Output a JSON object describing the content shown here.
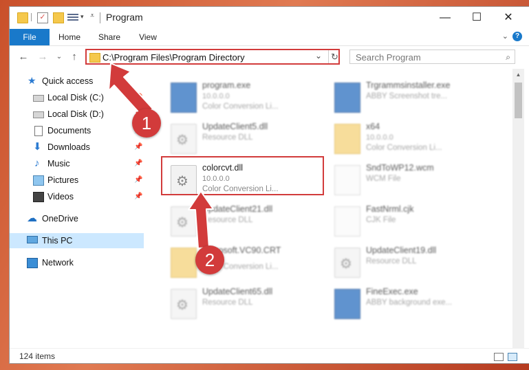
{
  "window": {
    "title": "Program"
  },
  "ribbon": {
    "tabs": [
      "File",
      "Home",
      "Share",
      "View"
    ],
    "help": "?"
  },
  "address": {
    "path": "C:\\Program Files\\Program Directory"
  },
  "search": {
    "placeholder": "Search Program"
  },
  "nav": {
    "items": [
      {
        "label": "Quick access",
        "icon": "star-icon"
      },
      {
        "label": "Local Disk (C:)",
        "icon": "disk-icon"
      },
      {
        "label": "Local Disk (D:)",
        "icon": "disk-icon"
      },
      {
        "label": "Documents",
        "icon": "documents-icon"
      },
      {
        "label": "Downloads",
        "icon": "downloads-icon"
      },
      {
        "label": "Music",
        "icon": "music-icon"
      },
      {
        "label": "Pictures",
        "icon": "pictures-icon"
      },
      {
        "label": "Videos",
        "icon": "videos-icon"
      },
      {
        "label": "OneDrive",
        "icon": "onedrive-icon"
      },
      {
        "label": "This PC",
        "icon": "pc-icon"
      },
      {
        "label": "Network",
        "icon": "network-icon"
      }
    ]
  },
  "files": [
    {
      "name": "program.exe",
      "version": "10.0.0.0",
      "desc": "Color Conversion Li...",
      "icon": "exe-icon"
    },
    {
      "name": "Trgrammsinstaller.exe",
      "version": "",
      "desc": "ABBY Screenshot tre...",
      "icon": "exe-icon"
    },
    {
      "name": "UpdateClient5.dll",
      "version": "",
      "desc": "Resource DLL",
      "icon": "dll-icon"
    },
    {
      "name": "x64",
      "version": "10.0.0.0",
      "desc": "Color Conversion Li...",
      "icon": "folder-icon"
    },
    {
      "name": "colorcvt.dll",
      "version": "10.0.0.0",
      "desc": "Color Conversion Li...",
      "icon": "dll-icon"
    },
    {
      "name": "SndToWP12.wcm",
      "version": "",
      "desc": "WCM File",
      "icon": "file-icon"
    },
    {
      "name": "UpdateClient21.dll",
      "version": "",
      "desc": "Resource DLL",
      "icon": "dll-icon"
    },
    {
      "name": "FastNrml.cjk",
      "version": "",
      "desc": "CJK File",
      "icon": "file-icon"
    },
    {
      "name": "Microsoft.VC90.CRT",
      "version": "",
      "desc": "Color Conversion Li...",
      "icon": "folder-icon"
    },
    {
      "name": "UpdateClient19.dll",
      "version": "",
      "desc": "Resource DLL",
      "icon": "dll-icon"
    },
    {
      "name": "UpdateClient65.dll",
      "version": "",
      "desc": "Resource DLL",
      "icon": "dll-icon"
    },
    {
      "name": "FineExec.exe",
      "version": "",
      "desc": "ABBY background exe...",
      "icon": "exe-icon"
    }
  ],
  "status": {
    "count": "124 items"
  },
  "callouts": [
    "1",
    "2"
  ],
  "colors": {
    "accent": "#1979ca",
    "highlight": "#d23b3b",
    "selection": "#cce8ff"
  }
}
